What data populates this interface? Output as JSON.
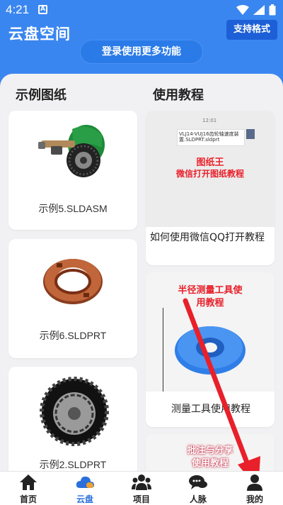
{
  "status": {
    "time": "4:21",
    "notif_glyph": "A"
  },
  "header": {
    "title": "云盘空间",
    "format_button": "支持格式",
    "login_button": "登录使用更多功能"
  },
  "samples": {
    "title": "示例图纸",
    "items": [
      {
        "name": "示例5.SLDASM",
        "icon": "saw-assembly"
      },
      {
        "name": "示例6.SLDPRT",
        "icon": "bronze-ring"
      },
      {
        "name": "示例2.SLDPRT",
        "icon": "wheel"
      }
    ]
  },
  "tutorials": {
    "title": "使用教程",
    "items": [
      {
        "caption": "如何使用微信QQ打开教程",
        "thumb_time": "12:01",
        "thumb_file": "VLJ14-VUJ16齿轮轴速度装置.SLDPRT.sldprt",
        "thumb_line1": "图纸王",
        "thumb_line2": "微信打开图纸教程"
      },
      {
        "caption": "测量工具使用教程",
        "thumb_line1": "半径测量工具使",
        "thumb_line2": "用教程"
      },
      {
        "caption": "",
        "thumb_line1": "批注与分享",
        "thumb_line2": "使用教程"
      }
    ]
  },
  "tabbar": {
    "tabs": [
      {
        "label": "首页",
        "icon": "home-icon",
        "active": false
      },
      {
        "label": "云盘",
        "icon": "cloud-icon",
        "active": true
      },
      {
        "label": "项目",
        "icon": "people-icon",
        "active": false
      },
      {
        "label": "人脉",
        "icon": "chat-icon",
        "active": false
      },
      {
        "label": "我的",
        "icon": "person-icon",
        "active": false
      }
    ]
  },
  "colors": {
    "brand": "#3a86f0",
    "accent_red": "#e8202a",
    "tab_active": "#2a6fdb"
  }
}
